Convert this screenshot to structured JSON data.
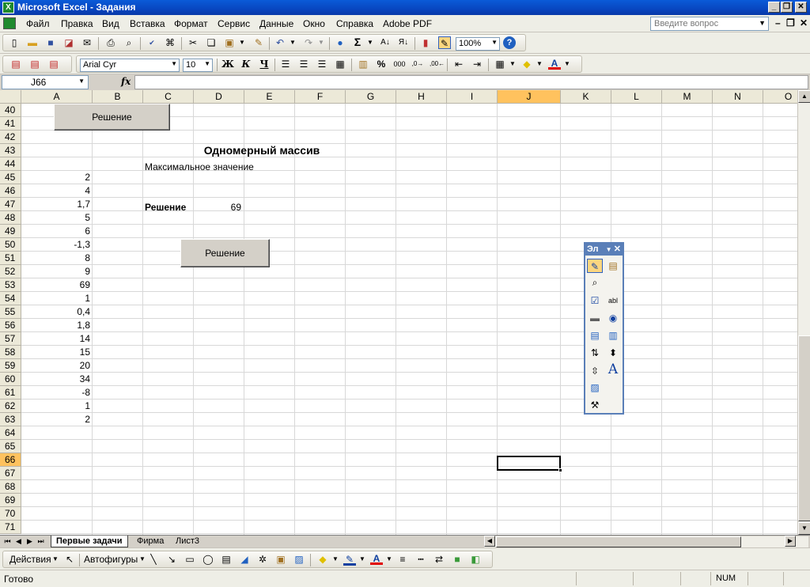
{
  "window": {
    "title": "Microsoft Excel - Задания",
    "icon": "excel-icon"
  },
  "menu": {
    "items": [
      "Файл",
      "Правка",
      "Вид",
      "Вставка",
      "Формат",
      "Сервис",
      "Данные",
      "Окно",
      "Справка",
      "Adobe PDF"
    ],
    "ask_placeholder": "Введите вопрос"
  },
  "toolbar": {
    "zoom": "100%",
    "font_name": "Arial Cyr",
    "font_size": "10",
    "sigma": "Σ",
    "percent": "%",
    "thousands": "000",
    "bold": "Ж",
    "italic": "К",
    "underline": "Ч"
  },
  "formula_bar": {
    "name_box": "J66",
    "fx": "fx",
    "formula": ""
  },
  "grid": {
    "columns": [
      "A",
      "B",
      "C",
      "D",
      "E",
      "F",
      "G",
      "H",
      "I",
      "J",
      "K",
      "L",
      "M",
      "N",
      "O"
    ],
    "rows": [
      "40",
      "41",
      "42",
      "43",
      "44",
      "45",
      "46",
      "47",
      "48",
      "49",
      "50",
      "51",
      "52",
      "53",
      "54",
      "55",
      "56",
      "57",
      "58",
      "59",
      "60",
      "61",
      "62",
      "63",
      "64",
      "65",
      "66",
      "67",
      "68",
      "69",
      "70",
      "71"
    ],
    "selected_column": "J",
    "selected_row": "66",
    "column_a_values": [
      "2",
      "4",
      "1,7",
      "5",
      "6",
      "-1,3",
      "8",
      "9",
      "69",
      "1",
      "0,4",
      "1,8",
      "14",
      "15",
      "20",
      "34",
      "-8",
      "1",
      "2"
    ],
    "title": "Одномерный массив",
    "subtitle": "Максимальное значение",
    "result_label": "Решение",
    "result_value": "69",
    "button1": "Решение",
    "button2": "Решение"
  },
  "sheets": {
    "tabs": [
      "Первые задачи",
      "Фирма",
      "Лист3"
    ],
    "active": "Первые задачи"
  },
  "drawing": {
    "actions": "Действия",
    "autoshapes": "Автофигуры"
  },
  "status": {
    "ready": "Готово",
    "num": "NUM"
  },
  "forms_toolbar": {
    "title": "Эл"
  }
}
